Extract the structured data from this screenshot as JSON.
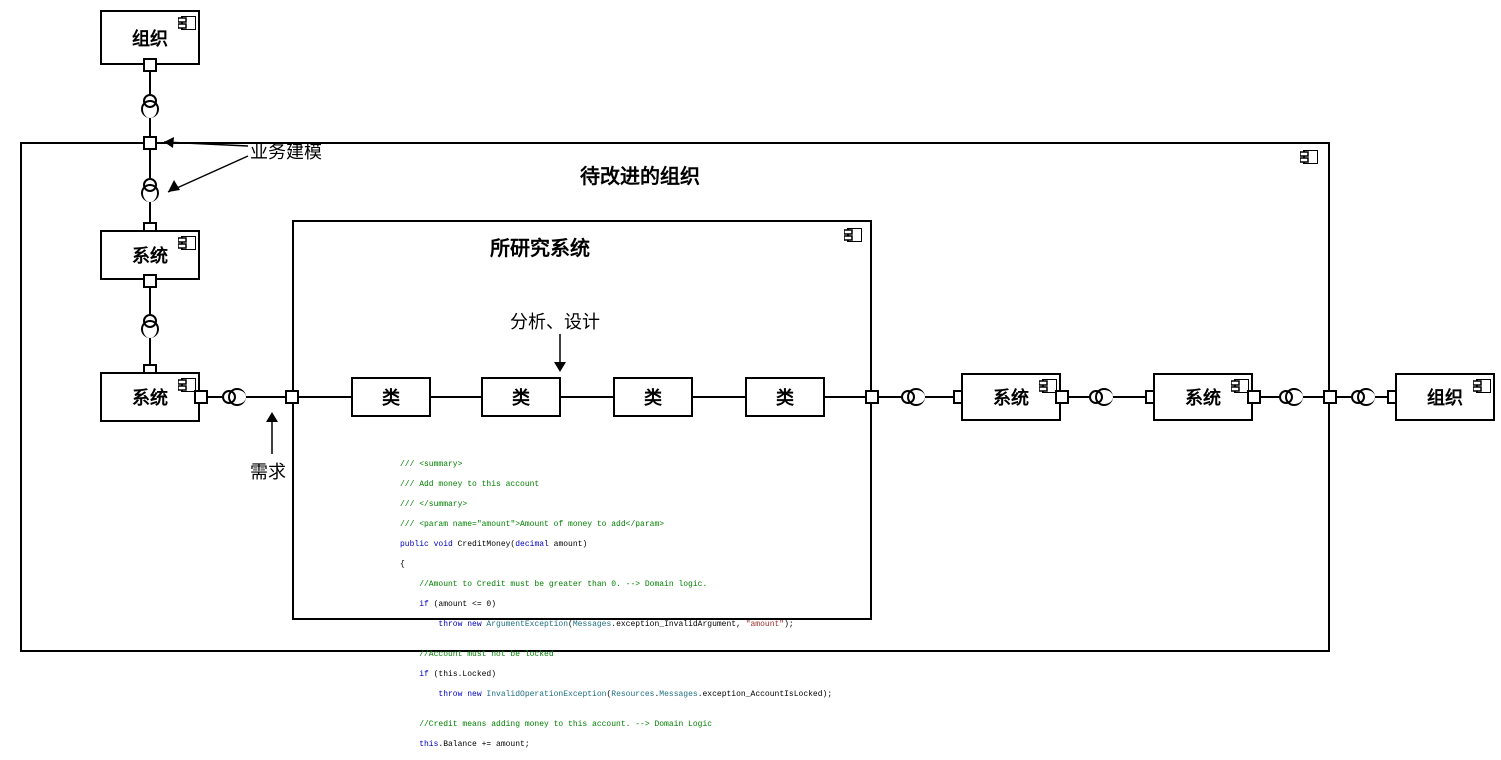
{
  "boxes": {
    "org_top": "组织",
    "system_mid": "系统",
    "system_bottom_left": "系统",
    "org_to_improve_title": "待改进的组织",
    "studied_system_title": "所研究系统",
    "class1": "类",
    "class2": "类",
    "class3": "类",
    "class4": "类",
    "system_right1": "系统",
    "system_right2": "系统",
    "org_right": "组织"
  },
  "labels": {
    "biz_modeling": "业务建模",
    "analysis_design": "分析、设计",
    "requirement": "需求"
  },
  "code": {
    "l1": "/// <summary>",
    "l2": "/// Add money to this account",
    "l3": "/// </summary>",
    "l4_a": "/// <param name=\"",
    "l4_b": "amount",
    "l4_c": "\">Amount of money to add</param>",
    "l5_a": "public void",
    "l5_b": " CreditMoney(",
    "l5_c": "decimal",
    "l5_d": " amount)",
    "l6": "{",
    "l7": "    //Amount to Credit must be greater than 0. --> Domain logic.",
    "l8_a": "    if",
    "l8_b": " (amount <= 0)",
    "l9_a": "        throw new ",
    "l9_b": "ArgumentException",
    "l9_c": "(",
    "l9_d": "Messages",
    "l9_e": ".exception_InvalidArgument, ",
    "l9_f": "\"amount\"",
    "l9_g": ");",
    "l10": "",
    "l11": "    //Account must not be locked",
    "l12_a": "    if",
    "l12_b": " (this.Locked)",
    "l13_a": "        throw new ",
    "l13_b": "InvalidOperationException",
    "l13_c": "(",
    "l13_d": "Resources",
    "l13_e": ".",
    "l13_f": "Messages",
    "l13_g": ".exception_AccountIsLocked);",
    "l14": "",
    "l15": "    //Credit means adding money to this account. --> Domain Logic",
    "l16_a": "    this",
    "l16_b": ".Balance += amount;"
  }
}
